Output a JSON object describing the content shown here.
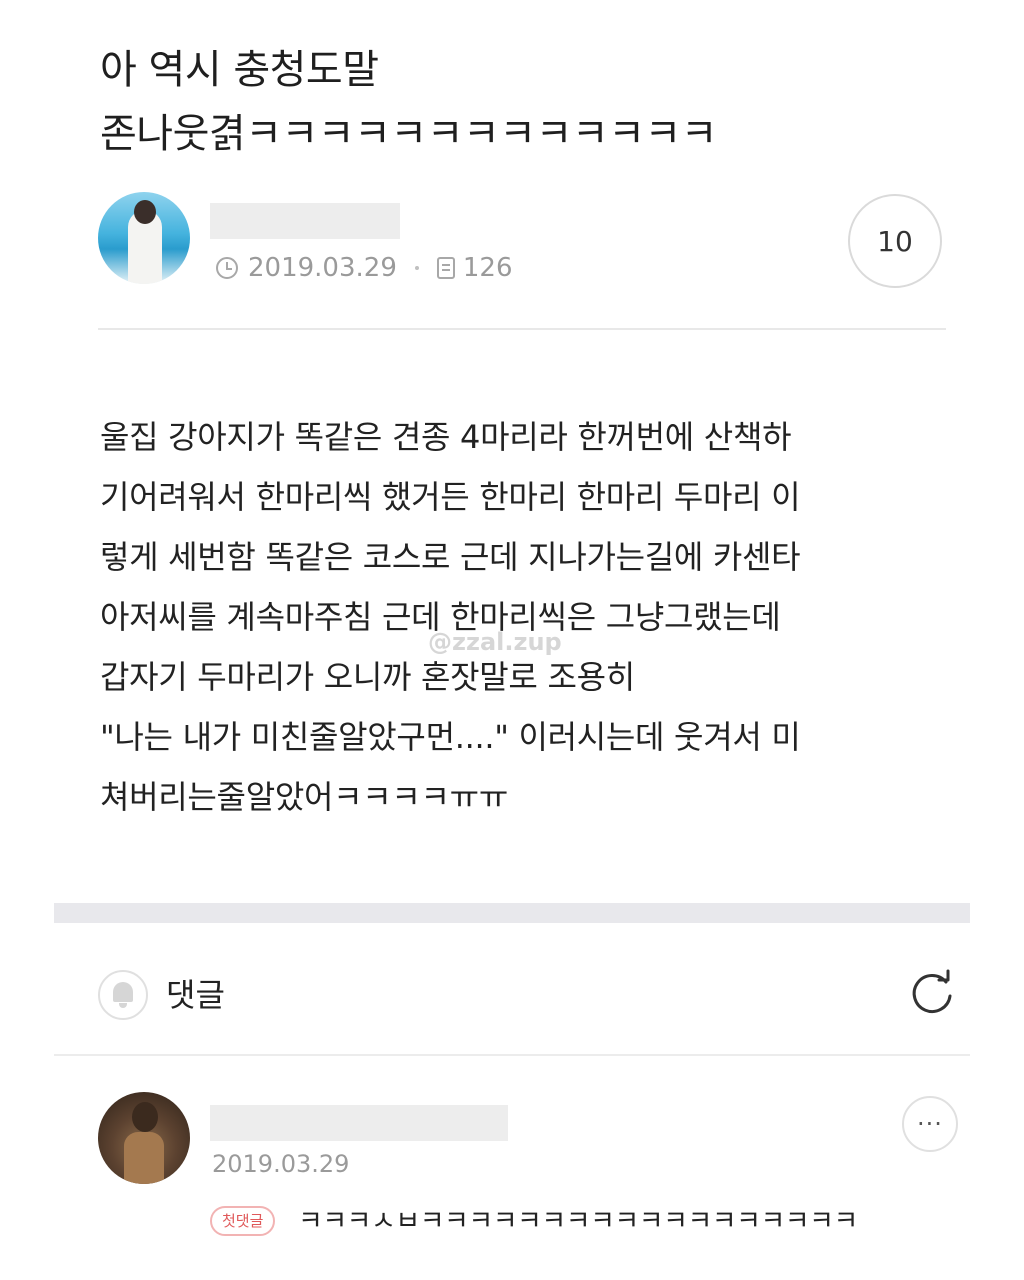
{
  "post": {
    "title": "아 역시 충청도말 존나웃겱ㅋㅋㅋㅋㅋㅋㅋㅋㅋㅋㅋㅋㅋ",
    "date": "2019.03.29",
    "views": "126",
    "comment_count": "10",
    "body_lines": [
      "울집 강아지가 똑같은 견종 4마리라 한꺼번에 산책하",
      "기어려워서 한마리씩 했거든 한마리 한마리 두마리 이",
      "렇게 세번함 똑같은 코스로 근데 지나가는길에 카센타",
      "아저씨를 계속마주침 근데 한마리씩은 그냥그랬는데",
      "갑자기 두마리가 오니까 혼잣말로 조용히",
      "\"나는 내가 미친줄알았구먼....\" 이러시는데 웃겨서 미",
      "쳐버리는줄알았어ㅋㅋㅋㅋㅠㅠ"
    ]
  },
  "watermark": "@zzal.zup",
  "comments": {
    "header_label": "댓글",
    "items": [
      {
        "date": "2019.03.29",
        "badge": "첫댓글",
        "text": "ㅋㅋㅋㅅㅂㅋㅋㅋㅋㅋㅋㅋㅋㅋㅋㅋㅋㅋㅋㅋㅋㅋㅋ",
        "more_label": "···"
      }
    ]
  },
  "icons": {
    "date": "clock-icon",
    "views": "document-icon",
    "notify": "bell-icon",
    "refresh": "refresh-icon",
    "more": "more-icon"
  },
  "colors": {
    "badge_text": "#e0595a",
    "badge_border": "#f2b3b3",
    "meta_text": "#9a9a9a",
    "separator_band": "#e8e8ec"
  }
}
